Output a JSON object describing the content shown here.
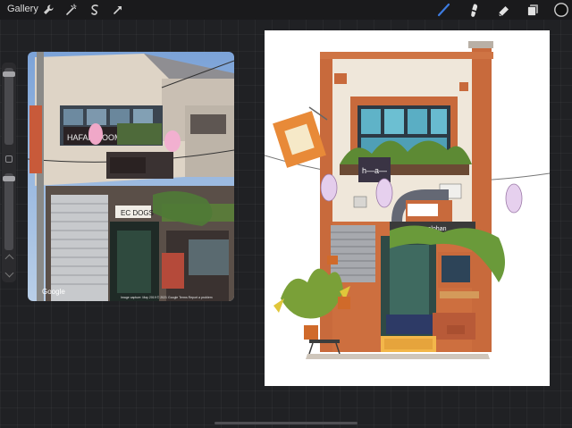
{
  "topbar": {
    "gallery_label": "Gallery",
    "left_tools": [
      "wrench-icon",
      "magic-wand-icon",
      "selection-icon",
      "transform-arrow-icon"
    ],
    "right_tools": [
      "brush-icon",
      "smudge-icon",
      "eraser-icon",
      "layers-icon",
      "color-swatch"
    ],
    "accent_color": "#3d7be0",
    "current_color": "#111111"
  },
  "reference_photo": {
    "watermark": "Google",
    "caption": "Image capture: May 2019  © 2021 Google   Terms   Report a problem",
    "sign_text": "HAFAR ROOM",
    "small_sign": "EC DOGS"
  },
  "artwork": {
    "window_sign": "h—a—",
    "shop_sign": "Angelohan",
    "notice_text": "Angelohan"
  }
}
